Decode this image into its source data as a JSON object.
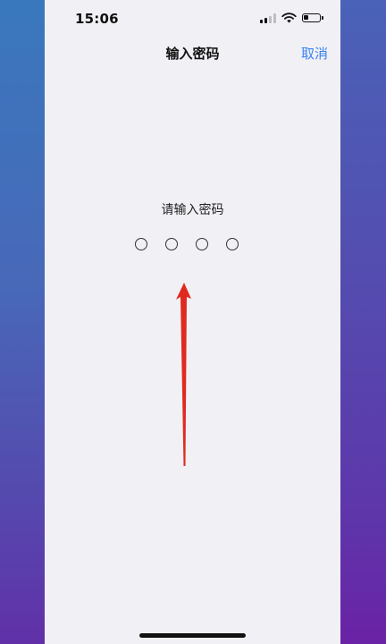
{
  "status_bar": {
    "time": "15:06",
    "signal_bars_active": 2,
    "signal_bars_total": 4,
    "battery_level": 0.3,
    "icons": [
      "cellular-signal-icon",
      "wifi-icon",
      "battery-icon"
    ]
  },
  "nav": {
    "title": "输入密码",
    "cancel_label": "取消"
  },
  "passcode": {
    "prompt": "请输入密码",
    "digits_total": 4,
    "digits_entered": 0
  },
  "annotation": {
    "type": "arrow",
    "color": "#e02a20"
  },
  "colors": {
    "accent": "#3a82f0",
    "screen_background": "#f1f0f5"
  }
}
